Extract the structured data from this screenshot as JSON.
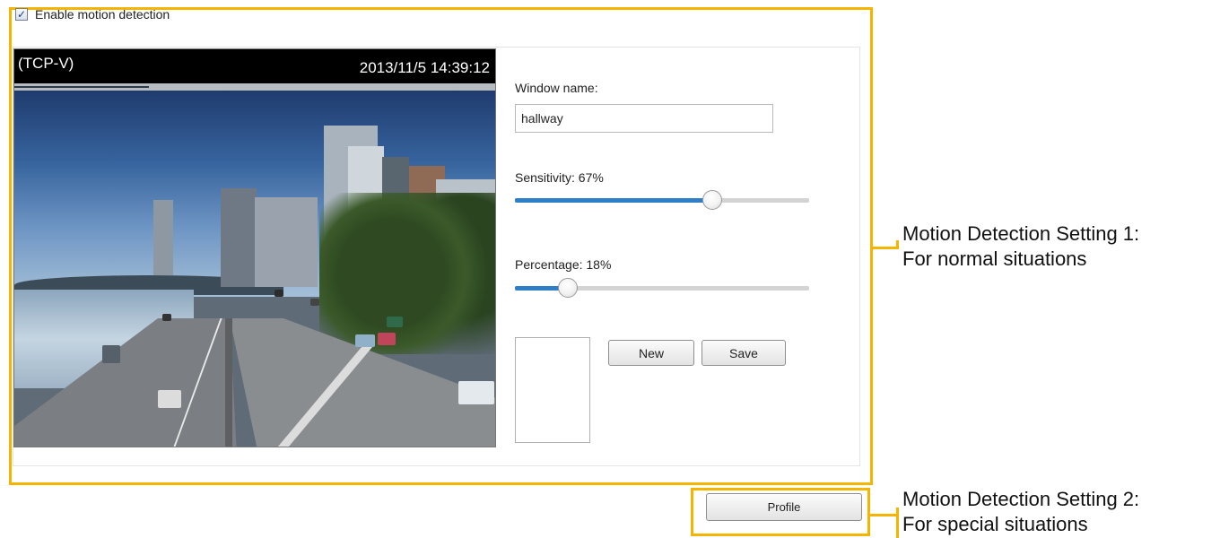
{
  "motion_detection": {
    "enable_label": "Enable motion detection",
    "enabled": true
  },
  "video": {
    "protocol": "(TCP-V)",
    "timestamp": "2013/11/5 14:39:12"
  },
  "window_settings": {
    "window_name_label": "Window name:",
    "window_name_value": "hallway",
    "sensitivity_label": "Sensitivity: 67%",
    "sensitivity_value": 67,
    "percentage_label": "Percentage: 18%",
    "percentage_value": 18,
    "new_label": "New",
    "save_label": "Save"
  },
  "profile": {
    "button_label": "Profile"
  },
  "callouts": {
    "setting1_line1": "Motion Detection Setting 1:",
    "setting1_line2": "For normal situations",
    "setting2_line1": "Motion Detection Setting 2:",
    "setting2_line2": "For special situations"
  },
  "colors": {
    "callout_accent": "#f5b400",
    "slider_fill": "#2f7fc8"
  },
  "icons": {
    "checkbox": "check-icon"
  }
}
